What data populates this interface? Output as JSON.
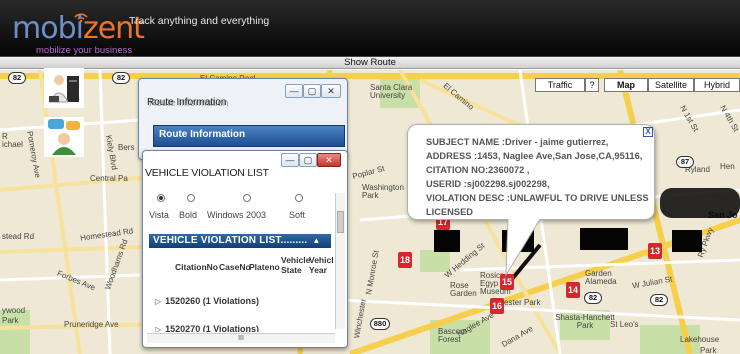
{
  "header": {
    "logo_prefix": "mobi",
    "logo_suffix": "zent",
    "logo_tagline": "mobilize your business",
    "tagline": "Track anything and everything"
  },
  "route_bar": {
    "label": "Show Route"
  },
  "map": {
    "controls": {
      "traffic": "Traffic",
      "help": "?",
      "map": "Map",
      "satellite": "Satellite",
      "hybrid": "Hybrid"
    },
    "labels": {
      "el_camino_real": "El Camino Real",
      "santa_clara_univ": "Santa Clara University",
      "el_camino": "El Camino",
      "poplar_st": "Poplar St",
      "washington_park": "Washington Park",
      "homestead_rd": "Homestead Rd",
      "kiely_blvd": "Kiely Blvd",
      "pomeroy_ave": "Pomeroy Ave",
      "central_pa": "Central Pa",
      "stead_rd": "stead Rd",
      "forbes_ave": "Forbes Ave",
      "woodhams_rd": "Woodhams Rd",
      "pruneridge_ave": "Pruneridge Ave",
      "monroe_st": "N Monroe St",
      "winchester": "Winchester",
      "w_hedding": "W Hedding St",
      "naglee_ave": "Naglee Ave",
      "dana_ave": "Dana Ave",
      "rosicrucian": "Rosicr Egyp Museum",
      "rose_garden": "Rose Garden",
      "chester_park": "ester Park",
      "shasta_hanchett": "Shasta-Hanchett Park",
      "garden_alameda": "Garden Alameda",
      "w_julian": "W Julian St",
      "st_leos": "St Leo's",
      "bascom_forest": "Bascom Forest",
      "lakehouse": "Lakehouse",
      "park": "Park",
      "ryland": "Ryland",
      "hen": "Hen",
      "n_1st": "N 1st St",
      "n_4th": "N 4th St",
      "san_jose": "San Jo",
      "ichael": "ichael",
      "r": "R",
      "bers": "Bers",
      "da": "Da",
      "ywood": "ywood",
      "park2": "Park",
      "ry_pkwy": "Ry Pkwy"
    },
    "shields": [
      "82",
      "82",
      "87",
      "87",
      "82",
      "82",
      "880",
      "880"
    ],
    "markers": [
      "18",
      "17",
      "15",
      "14",
      "16",
      "13"
    ]
  },
  "window_route": {
    "title": "Route Information",
    "section": "Route Information",
    "min": "—",
    "max": "▢",
    "close": "✕"
  },
  "window_violations": {
    "title": "VEHICLE VIOLATION LIST",
    "min": "—",
    "max": "▢",
    "close": "✕",
    "themes": [
      "Vista",
      "Bold",
      "Windows 2003",
      "Soft"
    ],
    "grid_title": "VEHICLE VIOLATION LIST.........",
    "sort_icon": "▲",
    "columns": [
      "CitationNo",
      "CaseNo",
      "Plateno",
      "Vehicle State",
      "Vehicle Year"
    ],
    "rows": [
      "1520260 (1 Violations)",
      "1520270 (1 Violations)"
    ],
    "hscroll_label": "III"
  },
  "popup": {
    "close": "X",
    "lines": [
      "SUBJECT NAME :Driver - jaime gutierrez,",
      "ADDRESS :1453, Naglee Ave,San Jose,CA,95116,",
      "CITATION NO:2360072 ,",
      "USERID :sj002298.sj002298,",
      "VIOLATION DESC :UNLAWFUL TO DRIVE UNLESS",
      "LICENSED"
    ]
  },
  "colors": {
    "header_bg": "#111111",
    "logo_blue": "#6d8fc7",
    "logo_orange": "#e9742c",
    "marker_red": "#d8262c",
    "grid_header": "#1b4f91"
  }
}
